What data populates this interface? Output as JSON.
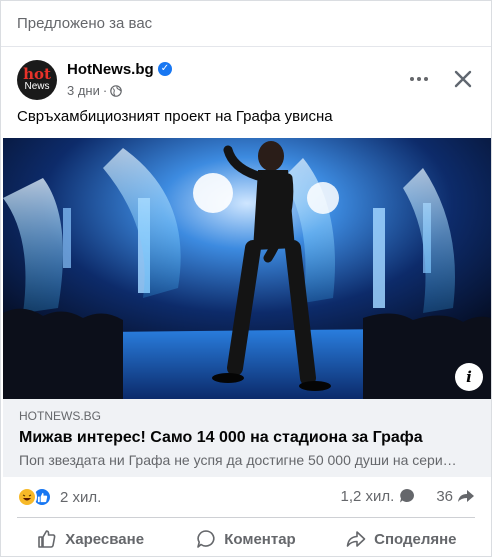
{
  "suggested_label": "Предложено за вас",
  "page": {
    "name": "HotNews.bg",
    "avatar_top": "hot",
    "avatar_bottom": "News",
    "time": "3 дни",
    "separator": "·"
  },
  "post": {
    "text": "Свръхамбициозният проект на Графа увисна"
  },
  "link": {
    "domain": "HOTNEWS.BG",
    "title": "Мижав интерес! Само 14 000 на стадиона за Графа",
    "description": "Поп звездата ни Графа не успя да достигне 50 000 души на сери…"
  },
  "stats": {
    "reactions_count": "2 хил.",
    "comments_count": "1,2 хил.",
    "shares_count": "36"
  },
  "actions": {
    "like": "Харесване",
    "comment": "Коментар",
    "share": "Споделяне"
  },
  "icons": {
    "verified": "verified-badge-icon",
    "globe": "globe-icon",
    "more": "more-icon",
    "close": "close-icon",
    "info": "info-icon"
  },
  "colors": {
    "brand_blue": "#1877f2",
    "secondary_text": "#65676b",
    "haha_yellow": "#f7b928",
    "link_bg": "#f0f2f5"
  }
}
